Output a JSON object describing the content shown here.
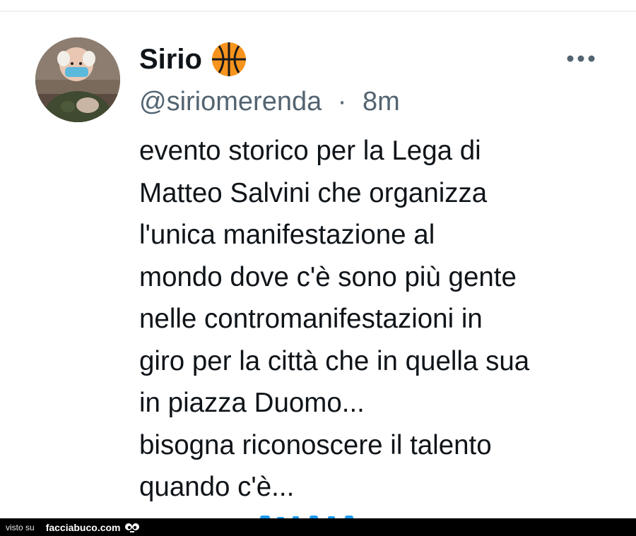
{
  "tweet": {
    "author": {
      "display_name": "Sirio",
      "badge_icon": "basketball-icon",
      "handle": "@siriomerenda",
      "separator": "·",
      "time": "8m"
    },
    "text": "evento storico per la Lega di\nMatteo Salvini che organizza\nl'unica manifestazione al\nmondo dove c'è sono più gente\nnelle contromanifestazioni in\ngiro per la città che in quella sua\nin piazza Duomo...\nbisogna riconoscere il talento\nquando c'è...",
    "more_icon": "more-horizontal-icon"
  },
  "footer": {
    "visto_label": "visto su",
    "site_label": "facciabuco.com",
    "logo_icon": "eyes-logo-icon"
  },
  "colors": {
    "text_primary": "#0f1419",
    "text_secondary": "#536471",
    "link_blue": "#1d9bf0",
    "badge_orange": "#f7941d",
    "footer_bg": "#000000"
  }
}
